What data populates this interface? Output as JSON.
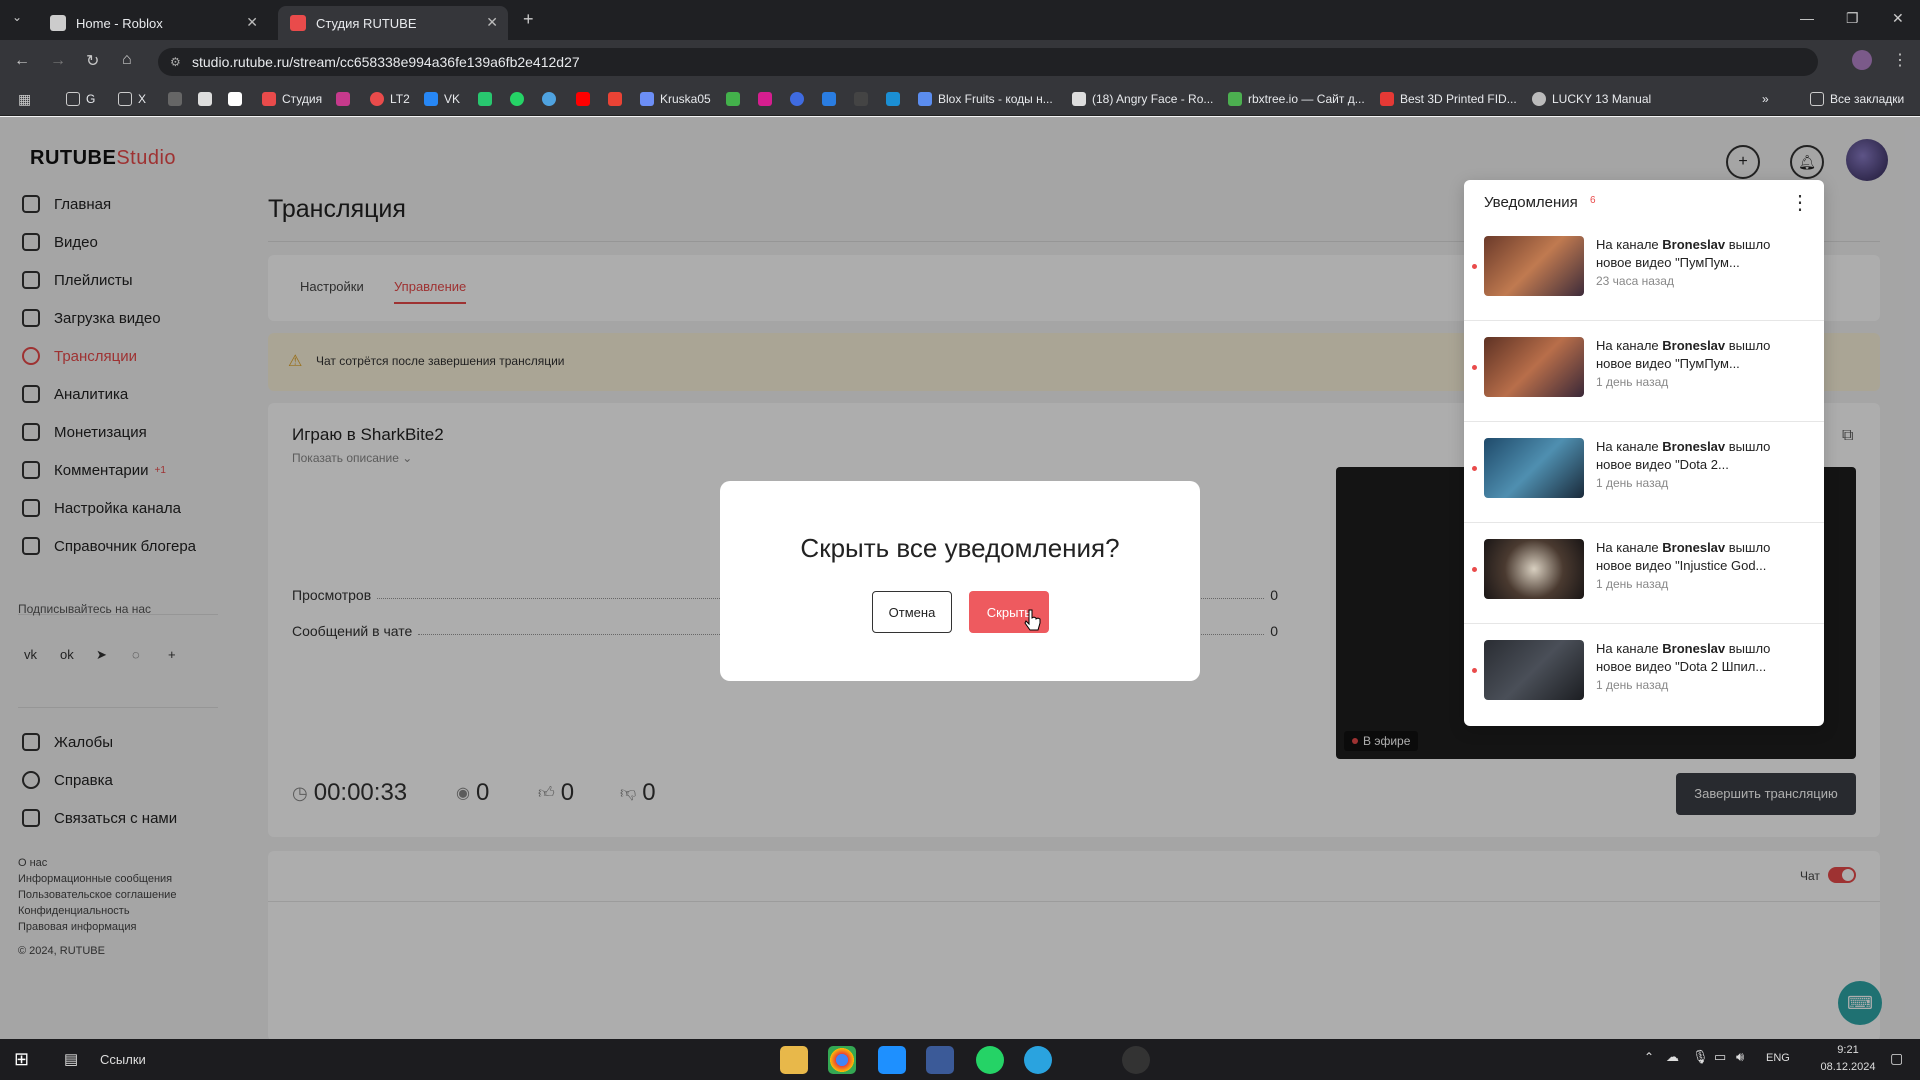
{
  "browser": {
    "tabs": [
      {
        "title": "Home - Roblox",
        "active": false
      },
      {
        "title": "Студия RUTUBE",
        "active": true
      }
    ],
    "url": "studio.rutube.ru/stream/cc658338e994a36fe139a6fb2e412d27",
    "bookmarks": [
      "G",
      "X",
      "Студия",
      "LT2",
      "VK",
      "Kruska05",
      "Blox Fruits - коды н...",
      "(18) Angry Face - Ro...",
      "rbxtree.io — Сайт д...",
      "Best 3D Printed FID...",
      "LUCKY 13 Manual",
      "Все закладки"
    ]
  },
  "logo": {
    "brand": "RUTUBE",
    "suffix": "Studio"
  },
  "sidebar": {
    "items": [
      {
        "label": "Главная"
      },
      {
        "label": "Видео"
      },
      {
        "label": "Плейлисты"
      },
      {
        "label": "Загрузка видео"
      },
      {
        "label": "Трансляции",
        "active": true
      },
      {
        "label": "Аналитика"
      },
      {
        "label": "Монетизация"
      },
      {
        "label": "Комментарии",
        "badge": "+1"
      },
      {
        "label": "Настройка канала"
      },
      {
        "label": "Справочник блогера"
      }
    ],
    "follow_label": "Подписывайтесь на нас",
    "bottom_items": [
      {
        "label": "Жалобы"
      },
      {
        "label": "Справка"
      },
      {
        "label": "Связаться с нами"
      }
    ],
    "footer_links": [
      "О нас",
      "Информационные сообщения",
      "Пользовательское соглашение",
      "Конфиденциальность",
      "Правовая информация",
      "© 2024, RUTUBE"
    ]
  },
  "main": {
    "title": "Трансляция",
    "tabs": [
      {
        "label": "Настройки",
        "active": false
      },
      {
        "label": "Управление",
        "active": true
      }
    ],
    "warning": "Чат сотрётся после завершения трансляции",
    "stream": {
      "title": "Играю в SharkBite2",
      "show_description": "Показать описание",
      "stats": [
        {
          "label": "Просмотров",
          "value": "0"
        },
        {
          "label": "Сообщений в чате",
          "value": "0"
        }
      ],
      "timer": "00:00:33",
      "viewers": "0",
      "likes": "0",
      "dislikes": "0",
      "live_badge": "В эфире",
      "end_button": "Завершить трансляцию"
    },
    "chat_label": "Чат",
    "chat_enabled": true
  },
  "notifications": {
    "title": "Уведомления",
    "count": "6",
    "items": [
      {
        "channel": "Broneslav",
        "prefix": "На канале ",
        "suffix": " вышло новое видео \"ПумПум...",
        "time": "23 часа назад"
      },
      {
        "channel": "Broneslav",
        "prefix": "На канале ",
        "suffix": " вышло новое видео \"ПумПум...",
        "time": "1 день назад"
      },
      {
        "channel": "Broneslav",
        "prefix": "На канале ",
        "suffix": " вышло новое видео \"Dota 2...",
        "time": "1 день назад"
      },
      {
        "channel": "Broneslav",
        "prefix": "На канале ",
        "suffix": " вышло новое видео \"Injustice God...",
        "time": "1 день назад"
      },
      {
        "channel": "Broneslav",
        "prefix": "На канале ",
        "suffix": " вышло новое видео \"Dota 2 Шпил...",
        "time": "1 день назад"
      }
    ]
  },
  "modal": {
    "title": "Скрыть все уведомления?",
    "cancel": "Отмена",
    "confirm": "Скрыть"
  },
  "taskbar": {
    "links_label": "Ссылки",
    "lang": "ENG",
    "time": "9:21",
    "date": "08.12.2024"
  },
  "colors": {
    "accent": "#e94b4b",
    "dark_button": "#3b3f46",
    "warning_bg": "#fbf3dc"
  }
}
